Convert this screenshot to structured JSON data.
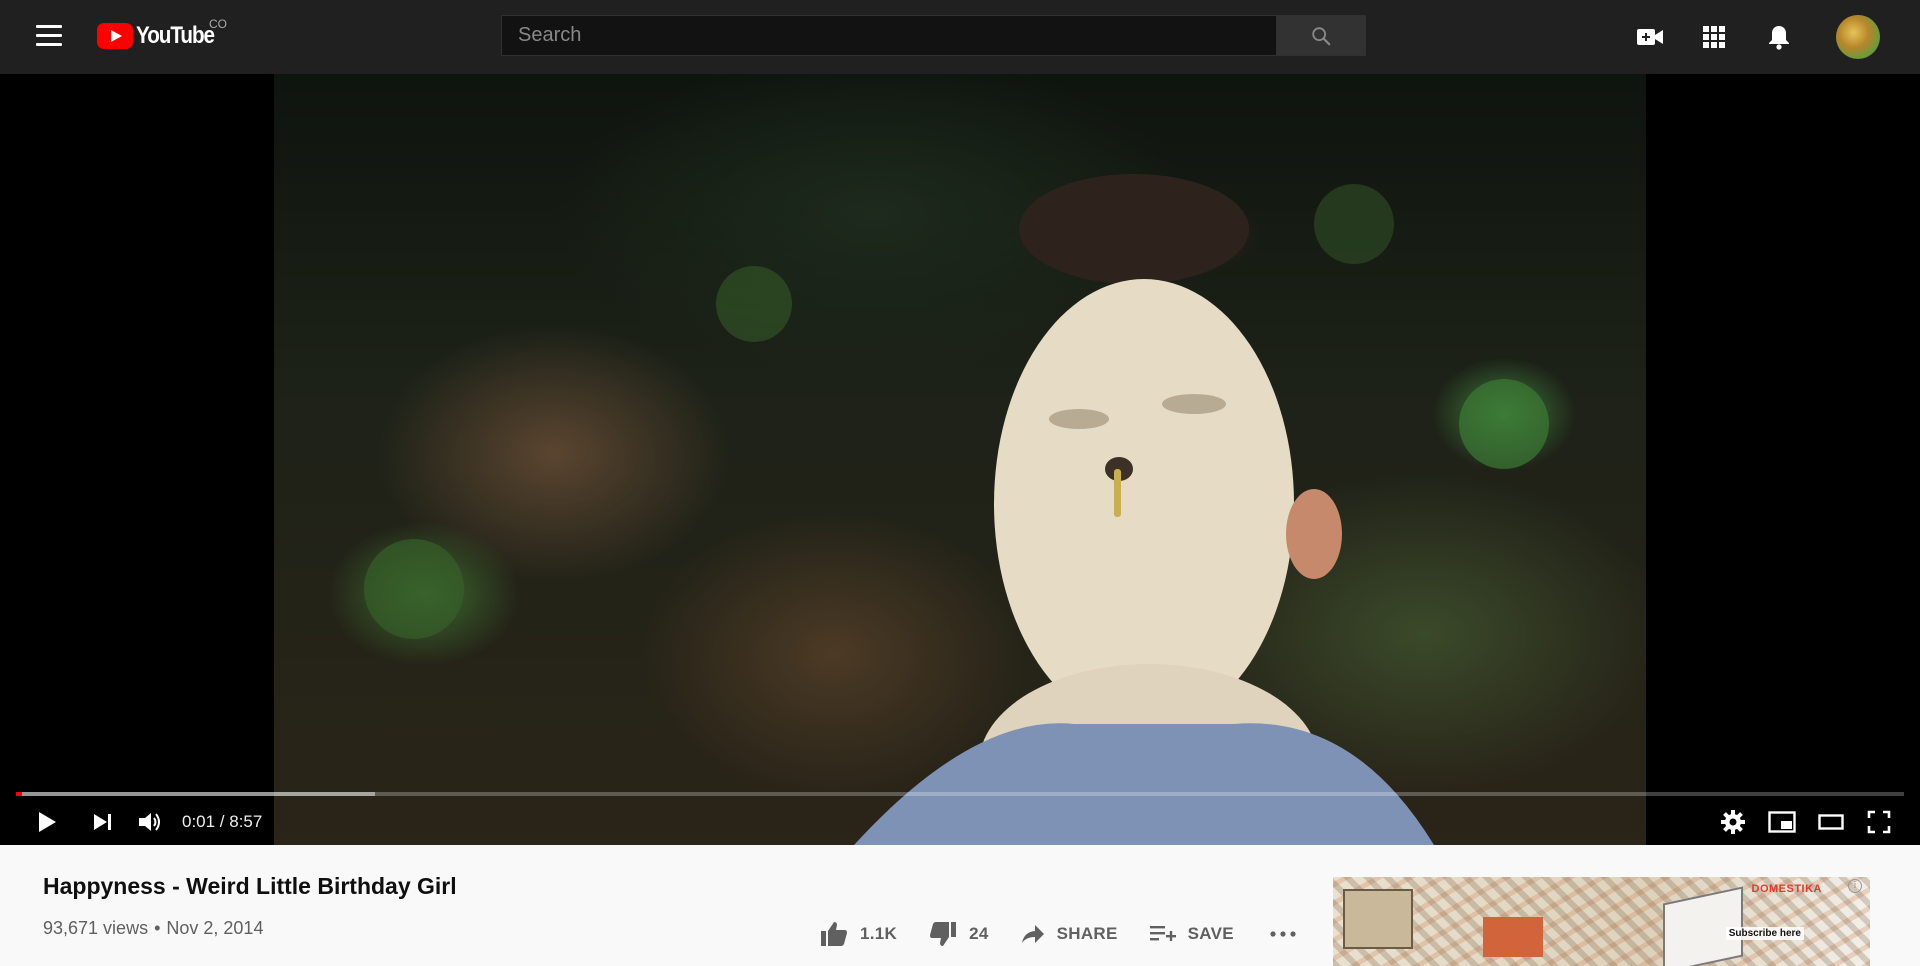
{
  "header": {
    "logo_text": "YouTube",
    "country_code": "CO",
    "search_placeholder": "Search"
  },
  "player": {
    "current_time": "0:01",
    "duration": "8:57",
    "time_display": "0:01 / 8:57",
    "played_fraction": 0.0,
    "buffered_fraction": 0.19
  },
  "video": {
    "title": "Happyness - Weird Little Birthday Girl",
    "views": "93,671 views",
    "separator": "•",
    "date": "Nov 2, 2014"
  },
  "actions": {
    "likes": "1.1K",
    "dislikes": "24",
    "share_label": "SHARE",
    "save_label": "SAVE"
  },
  "ad": {
    "brand": "DOMESTIKA",
    "cta": "Subscribe here",
    "info": "i"
  },
  "colors": {
    "brand_red": "#ff0000",
    "topbar": "#202020",
    "page_bg": "#f9f9f9"
  }
}
